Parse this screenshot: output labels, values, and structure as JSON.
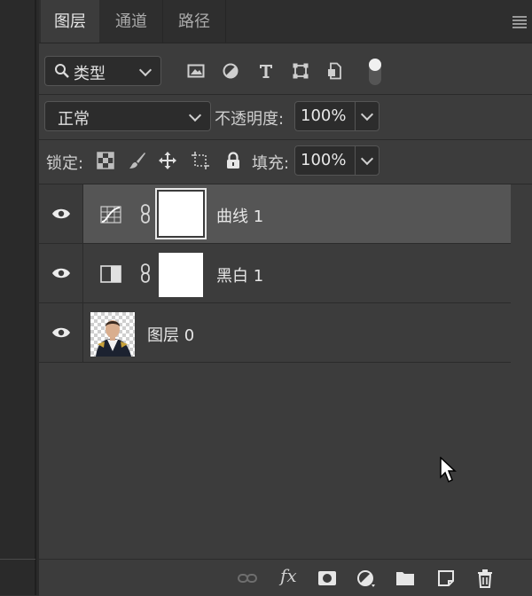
{
  "tabs": [
    {
      "label": "图层",
      "active": true
    },
    {
      "label": "通道",
      "active": false
    },
    {
      "label": "路径",
      "active": false
    }
  ],
  "filter": {
    "kind_label": "类型"
  },
  "blend": {
    "mode": "正常",
    "opacity_label": "不透明度:",
    "opacity_value": "100%"
  },
  "lock": {
    "label": "锁定:",
    "fill_label": "填充:",
    "fill_value": "100%"
  },
  "layers": [
    {
      "name": "曲线 1",
      "type": "curves",
      "selected": true,
      "visible": true
    },
    {
      "name": "黑白 1",
      "type": "black-white",
      "selected": false,
      "visible": true
    },
    {
      "name": "图层 0",
      "type": "pixel",
      "selected": false,
      "visible": true
    }
  ],
  "bottom": {
    "fx_label": "fx"
  },
  "colors": {
    "panel_bg": "#3c3c3c",
    "selected_row": "#555555",
    "tab_bar": "#2e2e2e"
  }
}
